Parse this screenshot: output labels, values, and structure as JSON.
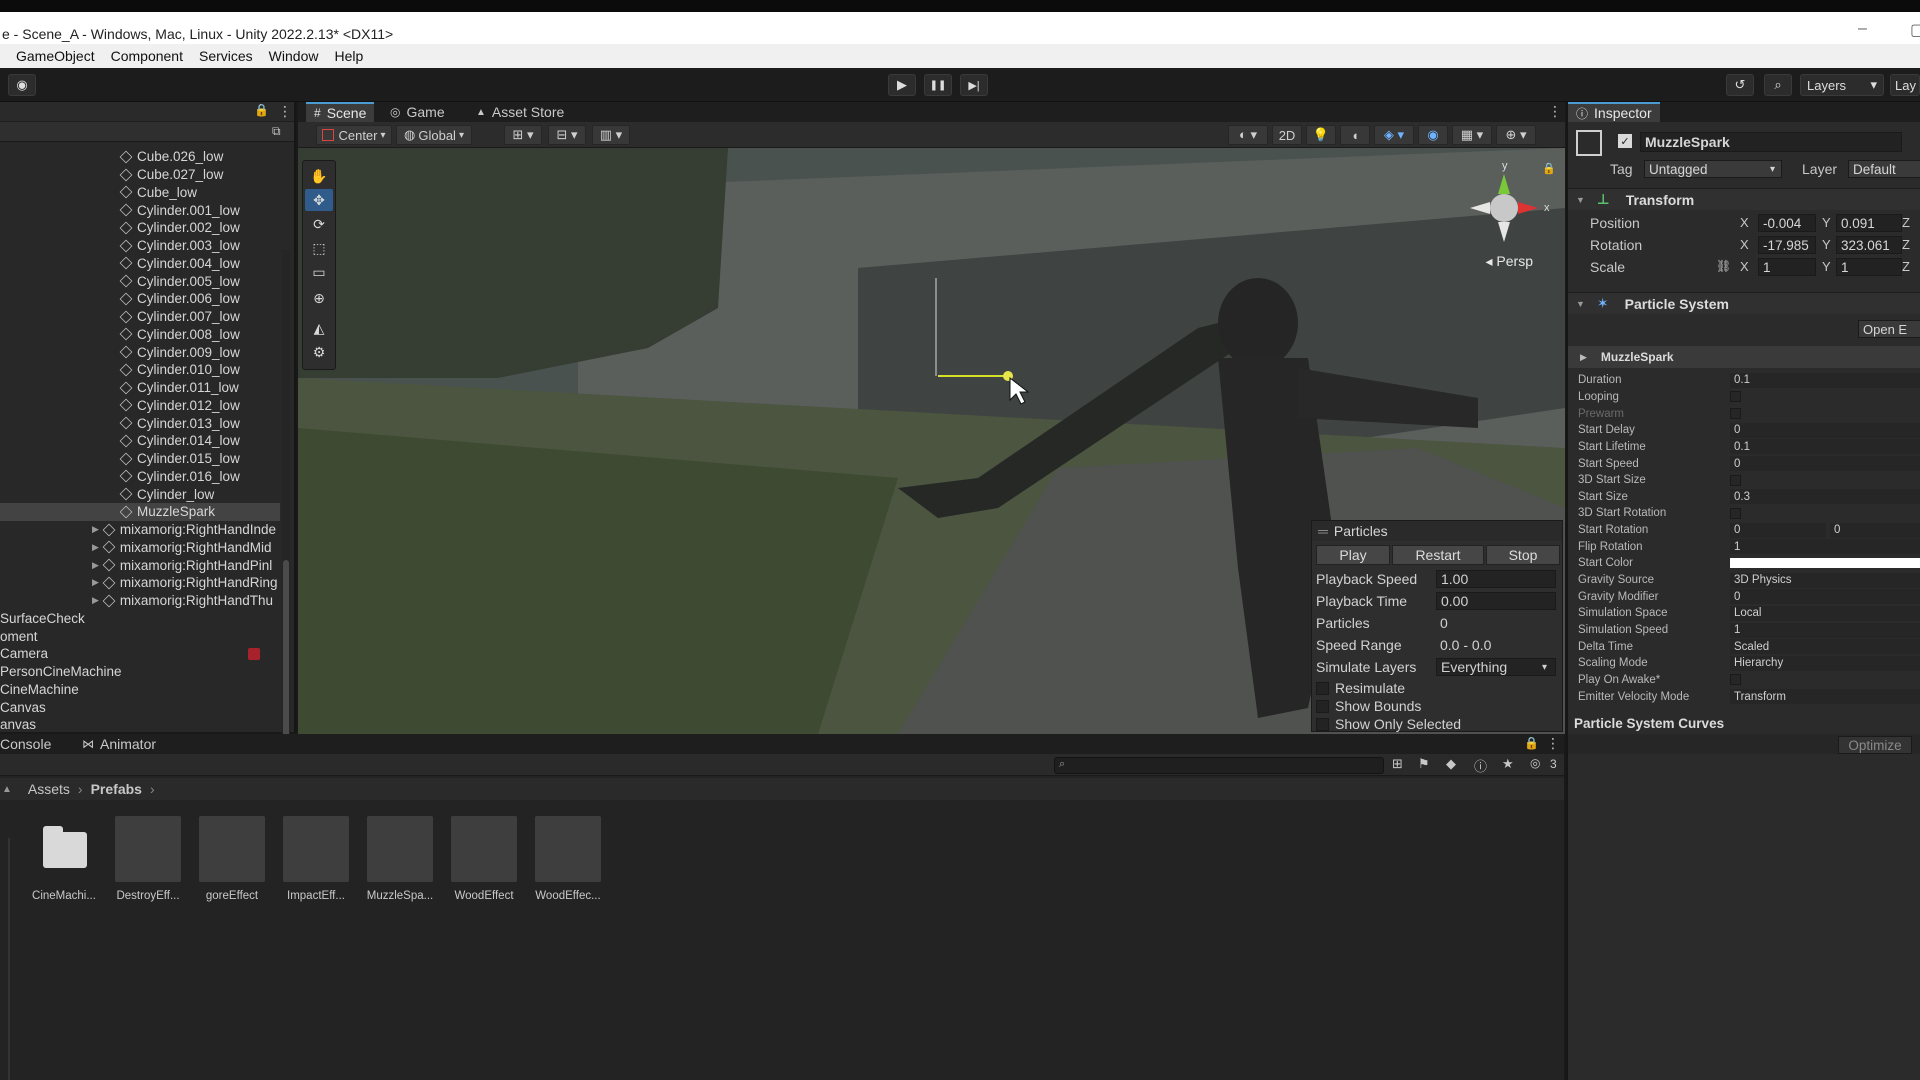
{
  "window": {
    "title": "e - Scene_A - Windows, Mac, Linux - Unity 2022.2.13* <DX11>",
    "minimize_glyph": "–",
    "maximize_glyph": "▢"
  },
  "menu": [
    "GameObject",
    "Component",
    "Services",
    "Window",
    "Help"
  ],
  "toolbar": {
    "play_icon": "play-icon",
    "pause_icon": "pause-icon",
    "step_icon": "step-icon",
    "play_glyph": "▶",
    "pause_glyph": "❚❚",
    "step_glyph": "▶|",
    "layers_label": "Layers",
    "layout_label": "Lay",
    "history_glyph": "↺",
    "search_glyph": "⌕",
    "account_glyph": "◉"
  },
  "hierarchy": {
    "lock_glyph": "🔒",
    "menu_glyph": "⋮",
    "items": [
      {
        "label": "Cube.026_low",
        "indent": "cube"
      },
      {
        "label": "Cube.027_low",
        "indent": "cube"
      },
      {
        "label": "Cube_low",
        "indent": "cube"
      },
      {
        "label": "Cylinder.001_low",
        "indent": "cube"
      },
      {
        "label": "Cylinder.002_low",
        "indent": "cube"
      },
      {
        "label": "Cylinder.003_low",
        "indent": "cube"
      },
      {
        "label": "Cylinder.004_low",
        "indent": "cube"
      },
      {
        "label": "Cylinder.005_low",
        "indent": "cube"
      },
      {
        "label": "Cylinder.006_low",
        "indent": "cube"
      },
      {
        "label": "Cylinder.007_low",
        "indent": "cube"
      },
      {
        "label": "Cylinder.008_low",
        "indent": "cube"
      },
      {
        "label": "Cylinder.009_low",
        "indent": "cube"
      },
      {
        "label": "Cylinder.010_low",
        "indent": "cube"
      },
      {
        "label": "Cylinder.011_low",
        "indent": "cube"
      },
      {
        "label": "Cylinder.012_low",
        "indent": "cube"
      },
      {
        "label": "Cylinder.013_low",
        "indent": "cube"
      },
      {
        "label": "Cylinder.014_low",
        "indent": "cube"
      },
      {
        "label": "Cylinder.015_low",
        "indent": "cube"
      },
      {
        "label": "Cylinder.016_low",
        "indent": "cube"
      },
      {
        "label": "Cylinder_low",
        "indent": "cube"
      },
      {
        "label": "MuzzleSpark",
        "indent": "cube",
        "selected": true
      },
      {
        "label": "mixamorig:RightHandInde",
        "indent": "child"
      },
      {
        "label": "mixamorig:RightHandMid",
        "indent": "child"
      },
      {
        "label": "mixamorig:RightHandPinl",
        "indent": "child"
      },
      {
        "label": "mixamorig:RightHandRing",
        "indent": "child"
      },
      {
        "label": "mixamorig:RightHandThu",
        "indent": "child"
      },
      {
        "label": "SurfaceCheck",
        "indent": "root"
      },
      {
        "label": "oment",
        "indent": "root"
      },
      {
        "label": "Camera",
        "indent": "root"
      },
      {
        "label": "PersonCineMachine",
        "indent": "root"
      },
      {
        "label": "CineMachine",
        "indent": "root"
      },
      {
        "label": "Canvas",
        "indent": "root"
      },
      {
        "label": "anvas",
        "indent": "root"
      }
    ]
  },
  "scene": {
    "tabs": [
      "Scene",
      "Game",
      "Asset Store"
    ],
    "tab_icons": [
      "#",
      "◎",
      "▲"
    ],
    "pivot": "Center",
    "space": "Global",
    "mode_2d": "2D",
    "persp_label": "◂ Persp",
    "tools": [
      "✋",
      "✥",
      "⟳",
      "⬚",
      "▭",
      "⊕",
      "◭",
      "⚙"
    ],
    "gizmo": {
      "x": "x",
      "y": "y"
    }
  },
  "particles_panel": {
    "title": "Particles",
    "buttons": [
      "Play",
      "Restart",
      "Stop"
    ],
    "rows": [
      {
        "label": "Playback Speed",
        "value": "1.00",
        "boxed": true
      },
      {
        "label": "Playback Time",
        "value": "0.00",
        "boxed": true
      },
      {
        "label": "Particles",
        "value": "0",
        "boxed": false
      },
      {
        "label": "Speed Range",
        "value": "0.0 - 0.0",
        "boxed": false
      },
      {
        "label": "Simulate Layers",
        "value": "Everything",
        "boxed": true
      }
    ],
    "toggles": [
      "Resimulate",
      "Show Bounds",
      "Show Only Selected"
    ]
  },
  "inspector": {
    "tab": "Inspector",
    "object_name": "MuzzleSpark",
    "tag_label": "Tag",
    "tag_value": "Untagged",
    "layer_label": "Layer",
    "layer_value": "Default",
    "transform_title": "Transform",
    "position_label": "Position",
    "position": {
      "x": "-0.004",
      "y": "0.091"
    },
    "rotation_label": "Rotation",
    "rotation": {
      "x": "-17.985",
      "y": "323.061"
    },
    "scale_label": "Scale",
    "scale": {
      "x": "1",
      "y": "1"
    },
    "axis": {
      "x": "X",
      "y": "Y",
      "z": "Z"
    },
    "particle_title": "Particle System",
    "open_editor": "Open E",
    "ps_name": "MuzzleSpark",
    "ps_rows": [
      {
        "label": "Duration",
        "value": "0.1"
      },
      {
        "label": "Looping",
        "value": "",
        "check": true
      },
      {
        "label": "Prewarm",
        "value": "",
        "check": true,
        "dim": true
      },
      {
        "label": "Start Delay",
        "value": "0"
      },
      {
        "label": "Start Lifetime",
        "value": "0.1"
      },
      {
        "label": "Start Speed",
        "value": "0"
      },
      {
        "label": "3D Start Size",
        "value": "",
        "check": true
      },
      {
        "label": "Start Size",
        "value": "0.3"
      },
      {
        "label": "3D Start Rotation",
        "value": "",
        "check": true
      },
      {
        "label": "Start Rotation",
        "value": "0",
        "value2": "0"
      },
      {
        "label": "Flip Rotation",
        "value": "1"
      },
      {
        "label": "Start Color",
        "value": "",
        "color": "#ffffff"
      },
      {
        "label": "Gravity Source",
        "value": "3D Physics"
      },
      {
        "label": "Gravity Modifier",
        "value": "0"
      },
      {
        "label": "Simulation Space",
        "value": "Local"
      },
      {
        "label": "Simulation Speed",
        "value": "1"
      },
      {
        "label": "Delta Time",
        "value": "Scaled"
      },
      {
        "label": "Scaling Mode",
        "value": "Hierarchy"
      },
      {
        "label": "Play On Awake*",
        "value": "",
        "check": true
      },
      {
        "label": "Emitter Velocity Mode",
        "value": "Transform"
      }
    ],
    "curves_title": "Particle System Curves",
    "optimize": "Optimize"
  },
  "bottom": {
    "tabs": [
      "Console",
      "Animator"
    ],
    "breadcrumb": [
      "Assets",
      "Prefabs"
    ],
    "hidden_count": "3",
    "assets": [
      {
        "name": "CineMachi...",
        "folder": true
      },
      {
        "name": "DestroyEff...",
        "folder": false
      },
      {
        "name": "goreEffect",
        "folder": false
      },
      {
        "name": "ImpactEff...",
        "folder": false
      },
      {
        "name": "MuzzleSpa...",
        "folder": false
      },
      {
        "name": "WoodEffect",
        "folder": false
      },
      {
        "name": "WoodEffec...",
        "folder": false
      }
    ]
  },
  "colors": {
    "accent": "#4b9cd3",
    "panel": "#282828",
    "selection": "#434343"
  }
}
